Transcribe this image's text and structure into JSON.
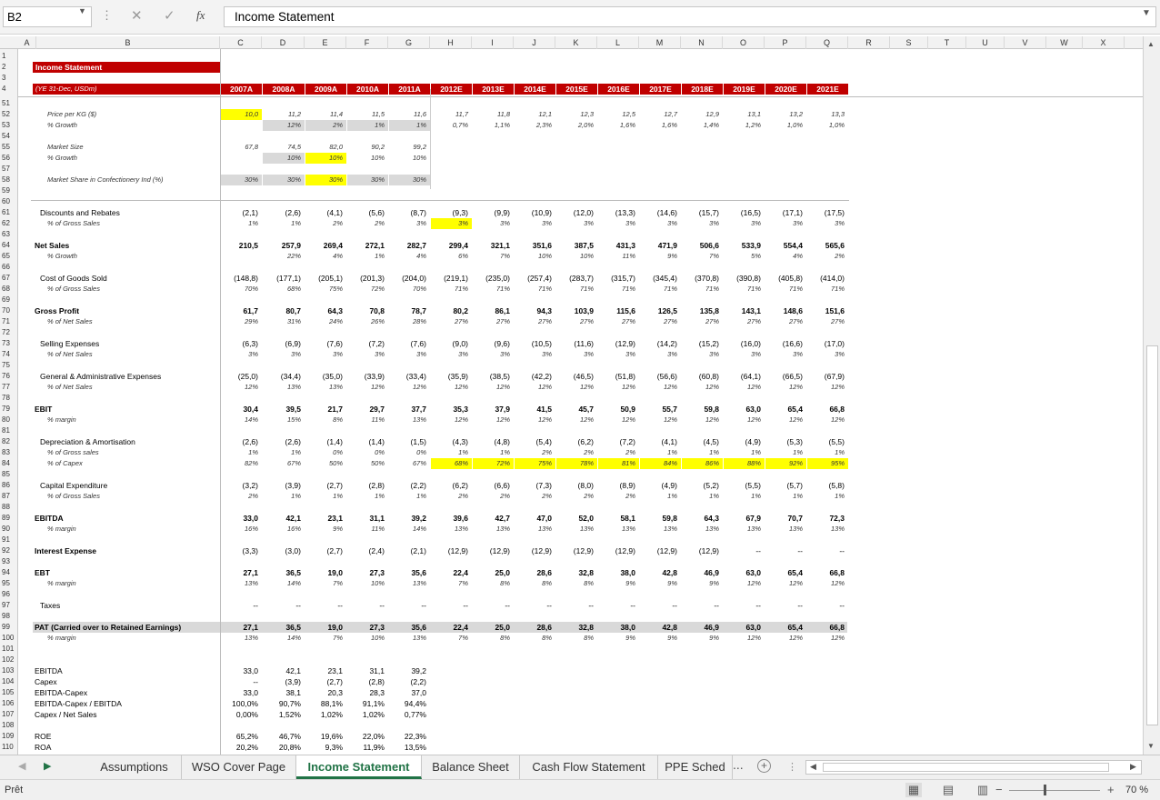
{
  "formula_bar": {
    "name_box": "B2",
    "formula": "Income Statement"
  },
  "columns": [
    "A",
    "B",
    "C",
    "D",
    "E",
    "F",
    "G",
    "H",
    "I",
    "J",
    "K",
    "L",
    "M",
    "N",
    "O",
    "P",
    "Q",
    "R",
    "S",
    "T",
    "U",
    "V",
    "W",
    "X"
  ],
  "header": {
    "title": "Income Statement",
    "units": "(YE 31-Dec, USDm)",
    "years": [
      "2007A",
      "2008A",
      "2009A",
      "2010A",
      "2011A",
      "2012E",
      "2013E",
      "2014E",
      "2015E",
      "2016E",
      "2017E",
      "2018E",
      "2019E",
      "2020E",
      "2021E"
    ]
  },
  "rows": [
    {
      "n": "51",
      "label": "",
      "style": "none",
      "vals": []
    },
    {
      "n": "52",
      "label": "Price per KG ($)",
      "style": "it",
      "vals": [
        "10,0",
        "11,2",
        "11,4",
        "11,5",
        "11,6",
        "11,7",
        "11,8",
        "12,1",
        "12,3",
        "12,5",
        "12,7",
        "12,9",
        "13,1",
        "13,2",
        "13,3"
      ],
      "hl": {
        "0": "yl"
      }
    },
    {
      "n": "53",
      "label": "% Growth",
      "style": "it",
      "vals": [
        "",
        "12%",
        "2%",
        "1%",
        "1%",
        "0,7%",
        "1,1%",
        "2,3%",
        "2,0%",
        "1,6%",
        "1,6%",
        "1,4%",
        "1,2%",
        "1,0%",
        "1,0%"
      ],
      "hl": {
        "1": "gy",
        "2": "gy",
        "3": "gy",
        "4": "gy"
      }
    },
    {
      "n": "54",
      "label": "",
      "style": "none",
      "vals": []
    },
    {
      "n": "55",
      "label": "Market Size",
      "style": "it",
      "vals": [
        "67,8",
        "74,5",
        "82,0",
        "90,2",
        "99,2"
      ]
    },
    {
      "n": "56",
      "label": "% Growth",
      "style": "it",
      "vals": [
        "",
        "10%",
        "10%",
        "10%",
        "10%"
      ],
      "hl": {
        "1": "gy",
        "2": "yl"
      }
    },
    {
      "n": "57",
      "label": "",
      "style": "none",
      "vals": []
    },
    {
      "n": "58",
      "label": "Market Share in Confectionery Ind (%)",
      "style": "it",
      "vals": [
        "30%",
        "30%",
        "30%",
        "30%",
        "30%"
      ],
      "hl": {
        "0": "gy",
        "1": "gy",
        "2": "yl",
        "3": "gy",
        "4": "gy"
      }
    },
    {
      "n": "59",
      "label": "",
      "style": "none",
      "vals": []
    },
    {
      "n": "60",
      "label": "",
      "style": "none",
      "vals": []
    },
    {
      "n": "61",
      "label": "Discounts and Rebates",
      "style": "n",
      "vals": [
        "(2,1)",
        "(2,6)",
        "(4,1)",
        "(5,6)",
        "(8,7)",
        "(9,3)",
        "(9,9)",
        "(10,9)",
        "(12,0)",
        "(13,3)",
        "(14,6)",
        "(15,7)",
        "(16,5)",
        "(17,1)",
        "(17,5)"
      ]
    },
    {
      "n": "62",
      "label": "% of Gross Sales",
      "style": "it",
      "vals": [
        "1%",
        "1%",
        "2%",
        "2%",
        "3%",
        "3%",
        "3%",
        "3%",
        "3%",
        "3%",
        "3%",
        "3%",
        "3%",
        "3%",
        "3%"
      ],
      "hl": {
        "5": "yl"
      }
    },
    {
      "n": "63",
      "label": "",
      "style": "none",
      "vals": []
    },
    {
      "n": "64",
      "label": "Net Sales",
      "style": "b",
      "vals": [
        "210,5",
        "257,9",
        "269,4",
        "272,1",
        "282,7",
        "299,4",
        "321,1",
        "351,6",
        "387,5",
        "431,3",
        "471,9",
        "506,6",
        "533,9",
        "554,4",
        "565,6"
      ]
    },
    {
      "n": "65",
      "label": "% Growth",
      "style": "it",
      "vals": [
        "",
        "22%",
        "4%",
        "1%",
        "4%",
        "6%",
        "7%",
        "10%",
        "10%",
        "11%",
        "9%",
        "7%",
        "5%",
        "4%",
        "2%"
      ]
    },
    {
      "n": "66",
      "label": "",
      "style": "none",
      "vals": []
    },
    {
      "n": "67",
      "label": "Cost of Goods Sold",
      "style": "n",
      "vals": [
        "(148,8)",
        "(177,1)",
        "(205,1)",
        "(201,3)",
        "(204,0)",
        "(219,1)",
        "(235,0)",
        "(257,4)",
        "(283,7)",
        "(315,7)",
        "(345,4)",
        "(370,8)",
        "(390,8)",
        "(405,8)",
        "(414,0)"
      ]
    },
    {
      "n": "68",
      "label": "% of Gross Sales",
      "style": "it",
      "vals": [
        "70%",
        "68%",
        "75%",
        "72%",
        "70%",
        "71%",
        "71%",
        "71%",
        "71%",
        "71%",
        "71%",
        "71%",
        "71%",
        "71%",
        "71%"
      ]
    },
    {
      "n": "69",
      "label": "",
      "style": "none",
      "vals": []
    },
    {
      "n": "70",
      "label": "Gross Profit",
      "style": "b",
      "vals": [
        "61,7",
        "80,7",
        "64,3",
        "70,8",
        "78,7",
        "80,2",
        "86,1",
        "94,3",
        "103,9",
        "115,6",
        "126,5",
        "135,8",
        "143,1",
        "148,6",
        "151,6"
      ]
    },
    {
      "n": "71",
      "label": "% of Net Sales",
      "style": "it",
      "vals": [
        "29%",
        "31%",
        "24%",
        "26%",
        "28%",
        "27%",
        "27%",
        "27%",
        "27%",
        "27%",
        "27%",
        "27%",
        "27%",
        "27%",
        "27%"
      ]
    },
    {
      "n": "72",
      "label": "",
      "style": "none",
      "vals": []
    },
    {
      "n": "73",
      "label": "Selling Expenses",
      "style": "n",
      "vals": [
        "(6,3)",
        "(6,9)",
        "(7,6)",
        "(7,2)",
        "(7,6)",
        "(9,0)",
        "(9,6)",
        "(10,5)",
        "(11,6)",
        "(12,9)",
        "(14,2)",
        "(15,2)",
        "(16,0)",
        "(16,6)",
        "(17,0)"
      ]
    },
    {
      "n": "74",
      "label": "% of Net Sales",
      "style": "it",
      "vals": [
        "3%",
        "3%",
        "3%",
        "3%",
        "3%",
        "3%",
        "3%",
        "3%",
        "3%",
        "3%",
        "3%",
        "3%",
        "3%",
        "3%",
        "3%"
      ]
    },
    {
      "n": "75",
      "label": "",
      "style": "none",
      "vals": []
    },
    {
      "n": "76",
      "label": "General & Administrative Expenses",
      "style": "n",
      "vals": [
        "(25,0)",
        "(34,4)",
        "(35,0)",
        "(33,9)",
        "(33,4)",
        "(35,9)",
        "(38,5)",
        "(42,2)",
        "(46,5)",
        "(51,8)",
        "(56,6)",
        "(60,8)",
        "(64,1)",
        "(66,5)",
        "(67,9)"
      ]
    },
    {
      "n": "77",
      "label": "% of Net Sales",
      "style": "it",
      "vals": [
        "12%",
        "13%",
        "13%",
        "12%",
        "12%",
        "12%",
        "12%",
        "12%",
        "12%",
        "12%",
        "12%",
        "12%",
        "12%",
        "12%",
        "12%"
      ]
    },
    {
      "n": "78",
      "label": "",
      "style": "none",
      "vals": []
    },
    {
      "n": "79",
      "label": "EBIT",
      "style": "b",
      "vals": [
        "30,4",
        "39,5",
        "21,7",
        "29,7",
        "37,7",
        "35,3",
        "37,9",
        "41,5",
        "45,7",
        "50,9",
        "55,7",
        "59,8",
        "63,0",
        "65,4",
        "66,8"
      ]
    },
    {
      "n": "80",
      "label": "% margin",
      "style": "it",
      "vals": [
        "14%",
        "15%",
        "8%",
        "11%",
        "13%",
        "12%",
        "12%",
        "12%",
        "12%",
        "12%",
        "12%",
        "12%",
        "12%",
        "12%",
        "12%"
      ]
    },
    {
      "n": "81",
      "label": "",
      "style": "none",
      "vals": []
    },
    {
      "n": "82",
      "label": "Depreciation & Amortisation",
      "style": "n",
      "vals": [
        "(2,6)",
        "(2,6)",
        "(1,4)",
        "(1,4)",
        "(1,5)",
        "(4,3)",
        "(4,8)",
        "(5,4)",
        "(6,2)",
        "(7,2)",
        "(4,1)",
        "(4,5)",
        "(4,9)",
        "(5,3)",
        "(5,5)"
      ]
    },
    {
      "n": "83",
      "label": "% of Gross sales",
      "style": "it",
      "vals": [
        "1%",
        "1%",
        "0%",
        "0%",
        "0%",
        "1%",
        "1%",
        "2%",
        "2%",
        "2%",
        "1%",
        "1%",
        "1%",
        "1%",
        "1%"
      ]
    },
    {
      "n": "84",
      "label": "% of Capex",
      "style": "it",
      "vals": [
        "82%",
        "67%",
        "50%",
        "50%",
        "67%",
        "68%",
        "72%",
        "75%",
        "78%",
        "81%",
        "84%",
        "86%",
        "88%",
        "92%",
        "95%"
      ],
      "hl": {
        "5": "yl",
        "6": "yl",
        "7": "yl",
        "8": "yl",
        "9": "yl",
        "10": "yl",
        "11": "yl",
        "12": "yl",
        "13": "yl",
        "14": "yl"
      }
    },
    {
      "n": "85",
      "label": "",
      "style": "none",
      "vals": []
    },
    {
      "n": "86",
      "label": "Capital Expenditure",
      "style": "n",
      "vals": [
        "(3,2)",
        "(3,9)",
        "(2,7)",
        "(2,8)",
        "(2,2)",
        "(6,2)",
        "(6,6)",
        "(7,3)",
        "(8,0)",
        "(8,9)",
        "(4,9)",
        "(5,2)",
        "(5,5)",
        "(5,7)",
        "(5,8)"
      ]
    },
    {
      "n": "87",
      "label": "% of Gross Sales",
      "style": "it",
      "vals": [
        "2%",
        "1%",
        "1%",
        "1%",
        "1%",
        "2%",
        "2%",
        "2%",
        "2%",
        "2%",
        "1%",
        "1%",
        "1%",
        "1%",
        "1%"
      ]
    },
    {
      "n": "88",
      "label": "",
      "style": "none",
      "vals": []
    },
    {
      "n": "89",
      "label": "EBITDA",
      "style": "b",
      "vals": [
        "33,0",
        "42,1",
        "23,1",
        "31,1",
        "39,2",
        "39,6",
        "42,7",
        "47,0",
        "52,0",
        "58,1",
        "59,8",
        "64,3",
        "67,9",
        "70,7",
        "72,3"
      ]
    },
    {
      "n": "90",
      "label": "% margin",
      "style": "it",
      "vals": [
        "16%",
        "16%",
        "9%",
        "11%",
        "14%",
        "13%",
        "13%",
        "13%",
        "13%",
        "13%",
        "13%",
        "13%",
        "13%",
        "13%",
        "13%"
      ]
    },
    {
      "n": "91",
      "label": "",
      "style": "none",
      "vals": []
    },
    {
      "n": "92",
      "label": "Interest Expense",
      "style": "b",
      "vals": [
        "(3,3)",
        "(3,0)",
        "(2,7)",
        "(2,4)",
        "(2,1)",
        "(12,9)",
        "(12,9)",
        "(12,9)",
        "(12,9)",
        "(12,9)",
        "(12,9)",
        "(12,9)",
        "--",
        "--",
        "--"
      ],
      "nb": true
    },
    {
      "n": "93",
      "label": "",
      "style": "none",
      "vals": []
    },
    {
      "n": "94",
      "label": "EBT",
      "style": "b",
      "vals": [
        "27,1",
        "36,5",
        "19,0",
        "27,3",
        "35,6",
        "22,4",
        "25,0",
        "28,6",
        "32,8",
        "38,0",
        "42,8",
        "46,9",
        "63,0",
        "65,4",
        "66,8"
      ]
    },
    {
      "n": "95",
      "label": "% margin",
      "style": "it",
      "vals": [
        "13%",
        "14%",
        "7%",
        "10%",
        "13%",
        "7%",
        "8%",
        "8%",
        "8%",
        "9%",
        "9%",
        "9%",
        "12%",
        "12%",
        "12%"
      ]
    },
    {
      "n": "96",
      "label": "",
      "style": "none",
      "vals": []
    },
    {
      "n": "97",
      "label": "Taxes",
      "style": "n",
      "vals": [
        "--",
        "--",
        "--",
        "--",
        "--",
        "--",
        "--",
        "--",
        "--",
        "--",
        "--",
        "--",
        "--",
        "--",
        "--"
      ]
    },
    {
      "n": "98",
      "label": "",
      "style": "none",
      "vals": []
    },
    {
      "n": "99",
      "label": "PAT (Carried over to Retained Earnings)",
      "style": "pat",
      "vals": [
        "27,1",
        "36,5",
        "19,0",
        "27,3",
        "35,6",
        "22,4",
        "25,0",
        "28,6",
        "32,8",
        "38,0",
        "42,8",
        "46,9",
        "63,0",
        "65,4",
        "66,8"
      ]
    },
    {
      "n": "100",
      "label": "% margin",
      "style": "it",
      "vals": [
        "13%",
        "14%",
        "7%",
        "10%",
        "13%",
        "7%",
        "8%",
        "8%",
        "8%",
        "9%",
        "9%",
        "9%",
        "12%",
        "12%",
        "12%"
      ]
    },
    {
      "n": "101",
      "label": "",
      "style": "none",
      "vals": []
    },
    {
      "n": "102",
      "label": "",
      "style": "none",
      "vals": []
    },
    {
      "n": "103",
      "label": "EBITDA",
      "style": "s",
      "vals": [
        "33,0",
        "42,1",
        "23,1",
        "31,1",
        "39,2"
      ]
    },
    {
      "n": "104",
      "label": "Capex",
      "style": "s",
      "vals": [
        "--",
        "(3,9)",
        "(2,7)",
        "(2,8)",
        "(2,2)"
      ]
    },
    {
      "n": "105",
      "label": "EBITDA-Capex",
      "style": "s",
      "vals": [
        "33,0",
        "38,1",
        "20,3",
        "28,3",
        "37,0"
      ]
    },
    {
      "n": "106",
      "label": "EBITDA-Capex / EBITDA",
      "style": "s",
      "vals": [
        "100,0%",
        "90,7%",
        "88,1%",
        "91,1%",
        "94,4%"
      ]
    },
    {
      "n": "107",
      "label": "Capex / Net Sales",
      "style": "s",
      "vals": [
        "0,00%",
        "1,52%",
        "1,02%",
        "1,02%",
        "0,77%"
      ]
    },
    {
      "n": "108",
      "label": "",
      "style": "none",
      "vals": []
    },
    {
      "n": "109",
      "label": "ROE",
      "style": "s",
      "vals": [
        "65,2%",
        "46,7%",
        "19,6%",
        "22,0%",
        "22,3%"
      ]
    },
    {
      "n": "110",
      "label": "ROA",
      "style": "s",
      "vals": [
        "20,2%",
        "20,8%",
        "9,3%",
        "11,9%",
        "13,5%"
      ]
    }
  ],
  "tabs": [
    "Assumptions",
    "WSO Cover Page",
    "Income Statement",
    "Balance Sheet",
    "Cash Flow Statement",
    "PPE Sched"
  ],
  "tab_more": "...",
  "active_tab": "Income Statement",
  "status": {
    "ready": "Prêt",
    "zoom": "70 %"
  },
  "colors": {
    "header_red": "#c00000",
    "highlight": "#ffff00",
    "grey": "#d9d9d9",
    "excel_green": "#217346"
  }
}
